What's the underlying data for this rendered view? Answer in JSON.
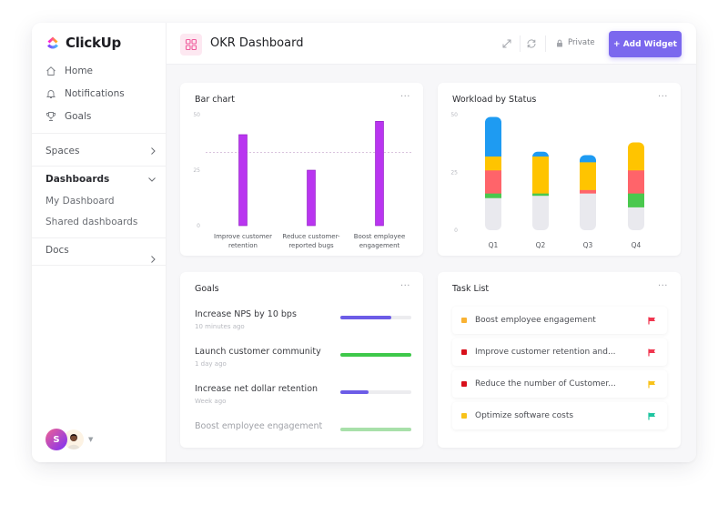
{
  "app": {
    "name": "ClickUp"
  },
  "sidebar": {
    "nav": [
      {
        "label": "Home",
        "icon": "home-icon"
      },
      {
        "label": "Notifications",
        "icon": "bell-icon"
      },
      {
        "label": "Goals",
        "icon": "trophy-icon"
      }
    ],
    "spaces": {
      "label": "Spaces"
    },
    "dashboards": {
      "label": "Dashboards",
      "items": [
        {
          "label": "My Dashboard"
        },
        {
          "label": "Shared dashboards"
        }
      ]
    },
    "docs": {
      "label": "Docs"
    },
    "user": {
      "initial": "S"
    }
  },
  "topbar": {
    "title": "OKR Dashboard",
    "privacy_label": "Private",
    "add_widget_label": "+ Add Widget"
  },
  "widgets": {
    "bar_chart": {
      "title": "Bar chart",
      "more": "···"
    },
    "workload": {
      "title": "Workload by Status",
      "more": "···"
    },
    "goals": {
      "title": "Goals",
      "more": "···",
      "items": [
        {
          "name": "Increase NPS by 10 bps",
          "time": "10 minutes ago",
          "progress": 0.72,
          "color": "#6c5ce7"
        },
        {
          "name": "Launch customer community",
          "time": "1 day ago",
          "progress": 1.0,
          "color": "#3ec84a"
        },
        {
          "name": "Increase net dollar retention",
          "time": "Week ago",
          "progress": 0.4,
          "color": "#6c5ce7"
        },
        {
          "name": "Boost employee engagement",
          "time": "",
          "progress": 1.0,
          "color": "#a8e0aa"
        }
      ]
    },
    "tasks": {
      "title": "Task List",
      "more": "···",
      "items": [
        {
          "name": "Boost employee engagement",
          "status_color": "#f9b233",
          "flag_color": "#f0364f"
        },
        {
          "name": "Improve customer retention and...",
          "status_color": "#d8101b",
          "flag_color": "#f0364f"
        },
        {
          "name": "Reduce the number of Customer...",
          "status_color": "#d8101b",
          "flag_color": "#f8c21a"
        },
        {
          "name": "Optimize software costs",
          "status_color": "#f8c21a",
          "flag_color": "#1ec5a0"
        }
      ]
    }
  },
  "chart_data": [
    {
      "type": "bar",
      "title": "Bar chart",
      "categories": [
        [
          "Improve customer",
          "retention"
        ],
        [
          "Reduce customer-",
          "reported bugs"
        ],
        [
          "Boost employee",
          "engagement"
        ]
      ],
      "values": [
        41,
        25,
        47
      ],
      "reference_line": 33,
      "yticks": [
        0,
        25,
        50
      ],
      "ylim": [
        0,
        50
      ],
      "color": "#b935f0",
      "xlabel": "",
      "ylabel": ""
    },
    {
      "type": "bar",
      "stacked": true,
      "title": "Workload by Status",
      "categories": [
        "Q1",
        "Q2",
        "Q3",
        "Q4"
      ],
      "yticks": [
        0,
        25,
        50
      ],
      "ylim": [
        0,
        50
      ],
      "series": [
        {
          "name": "gray",
          "color": "#e9e9ee",
          "values": [
            14,
            15,
            16,
            10
          ]
        },
        {
          "name": "green",
          "color": "#4ac84e",
          "values": [
            2,
            1,
            0,
            6
          ]
        },
        {
          "name": "red",
          "color": "#ff646a",
          "values": [
            10,
            0,
            1.5,
            10
          ]
        },
        {
          "name": "yellow",
          "color": "#ffc400",
          "values": [
            6,
            16,
            12,
            12
          ]
        },
        {
          "name": "blue",
          "color": "#1e9bf2",
          "values": [
            17,
            2,
            3,
            0
          ]
        }
      ],
      "xlabel": "",
      "ylabel": ""
    }
  ]
}
